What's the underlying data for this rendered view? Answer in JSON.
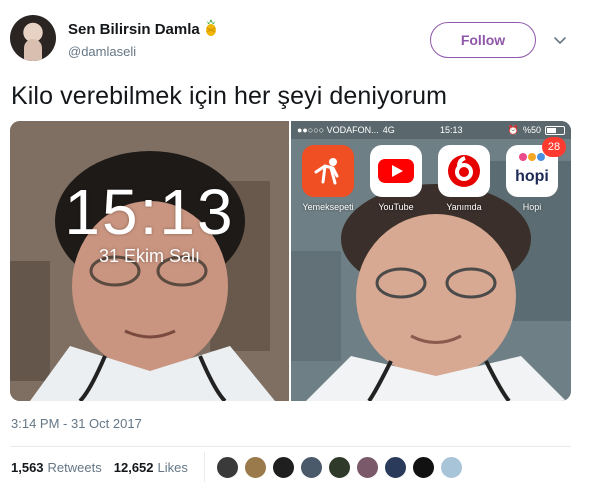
{
  "user": {
    "display_name": "Sen Bilirsin Damla",
    "handle": "@damlaseli"
  },
  "actions": {
    "follow_label": "Follow"
  },
  "tweet": {
    "text": "Kilo verebilmek için her şeyi deniyorum",
    "timestamp": "3:14 PM - 31 Oct 2017"
  },
  "media": {
    "lock_screen": {
      "time": "15:13",
      "date": "31 Ekim Salı"
    },
    "home_screen": {
      "carrier": "●●○○○ VODAFON...",
      "network": "4G",
      "time": "15:13",
      "battery": "%50",
      "apps": [
        {
          "label": "Yemeksepeti",
          "color": "#f04e23"
        },
        {
          "label": "YouTube",
          "color": "#ffffff"
        },
        {
          "label": "Yanımda",
          "color": "#ffffff"
        },
        {
          "label": "Hopi",
          "color": "#ffffff",
          "badge": "28"
        }
      ]
    }
  },
  "stats": {
    "retweets_count": "1,563",
    "retweets_label": "Retweets",
    "likes_count": "12,652",
    "likes_label": "Likes"
  },
  "colors": {
    "follow_accent": "#8f57a8",
    "muted_text": "#657786"
  },
  "icons": [
    "pineapple-icon",
    "chevron-down-icon"
  ]
}
